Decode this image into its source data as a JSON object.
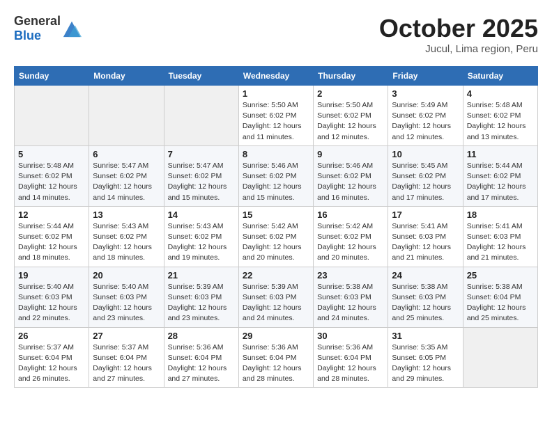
{
  "header": {
    "logo_general": "General",
    "logo_blue": "Blue",
    "month": "October 2025",
    "location": "Jucul, Lima region, Peru"
  },
  "weekdays": [
    "Sunday",
    "Monday",
    "Tuesday",
    "Wednesday",
    "Thursday",
    "Friday",
    "Saturday"
  ],
  "weeks": [
    [
      {
        "day": "",
        "info": ""
      },
      {
        "day": "",
        "info": ""
      },
      {
        "day": "",
        "info": ""
      },
      {
        "day": "1",
        "info": "Sunrise: 5:50 AM\nSunset: 6:02 PM\nDaylight: 12 hours\nand 11 minutes."
      },
      {
        "day": "2",
        "info": "Sunrise: 5:50 AM\nSunset: 6:02 PM\nDaylight: 12 hours\nand 12 minutes."
      },
      {
        "day": "3",
        "info": "Sunrise: 5:49 AM\nSunset: 6:02 PM\nDaylight: 12 hours\nand 12 minutes."
      },
      {
        "day": "4",
        "info": "Sunrise: 5:48 AM\nSunset: 6:02 PM\nDaylight: 12 hours\nand 13 minutes."
      }
    ],
    [
      {
        "day": "5",
        "info": "Sunrise: 5:48 AM\nSunset: 6:02 PM\nDaylight: 12 hours\nand 14 minutes."
      },
      {
        "day": "6",
        "info": "Sunrise: 5:47 AM\nSunset: 6:02 PM\nDaylight: 12 hours\nand 14 minutes."
      },
      {
        "day": "7",
        "info": "Sunrise: 5:47 AM\nSunset: 6:02 PM\nDaylight: 12 hours\nand 15 minutes."
      },
      {
        "day": "8",
        "info": "Sunrise: 5:46 AM\nSunset: 6:02 PM\nDaylight: 12 hours\nand 15 minutes."
      },
      {
        "day": "9",
        "info": "Sunrise: 5:46 AM\nSunset: 6:02 PM\nDaylight: 12 hours\nand 16 minutes."
      },
      {
        "day": "10",
        "info": "Sunrise: 5:45 AM\nSunset: 6:02 PM\nDaylight: 12 hours\nand 17 minutes."
      },
      {
        "day": "11",
        "info": "Sunrise: 5:44 AM\nSunset: 6:02 PM\nDaylight: 12 hours\nand 17 minutes."
      }
    ],
    [
      {
        "day": "12",
        "info": "Sunrise: 5:44 AM\nSunset: 6:02 PM\nDaylight: 12 hours\nand 18 minutes."
      },
      {
        "day": "13",
        "info": "Sunrise: 5:43 AM\nSunset: 6:02 PM\nDaylight: 12 hours\nand 18 minutes."
      },
      {
        "day": "14",
        "info": "Sunrise: 5:43 AM\nSunset: 6:02 PM\nDaylight: 12 hours\nand 19 minutes."
      },
      {
        "day": "15",
        "info": "Sunrise: 5:42 AM\nSunset: 6:02 PM\nDaylight: 12 hours\nand 20 minutes."
      },
      {
        "day": "16",
        "info": "Sunrise: 5:42 AM\nSunset: 6:02 PM\nDaylight: 12 hours\nand 20 minutes."
      },
      {
        "day": "17",
        "info": "Sunrise: 5:41 AM\nSunset: 6:03 PM\nDaylight: 12 hours\nand 21 minutes."
      },
      {
        "day": "18",
        "info": "Sunrise: 5:41 AM\nSunset: 6:03 PM\nDaylight: 12 hours\nand 21 minutes."
      }
    ],
    [
      {
        "day": "19",
        "info": "Sunrise: 5:40 AM\nSunset: 6:03 PM\nDaylight: 12 hours\nand 22 minutes."
      },
      {
        "day": "20",
        "info": "Sunrise: 5:40 AM\nSunset: 6:03 PM\nDaylight: 12 hours\nand 23 minutes."
      },
      {
        "day": "21",
        "info": "Sunrise: 5:39 AM\nSunset: 6:03 PM\nDaylight: 12 hours\nand 23 minutes."
      },
      {
        "day": "22",
        "info": "Sunrise: 5:39 AM\nSunset: 6:03 PM\nDaylight: 12 hours\nand 24 minutes."
      },
      {
        "day": "23",
        "info": "Sunrise: 5:38 AM\nSunset: 6:03 PM\nDaylight: 12 hours\nand 24 minutes."
      },
      {
        "day": "24",
        "info": "Sunrise: 5:38 AM\nSunset: 6:03 PM\nDaylight: 12 hours\nand 25 minutes."
      },
      {
        "day": "25",
        "info": "Sunrise: 5:38 AM\nSunset: 6:04 PM\nDaylight: 12 hours\nand 25 minutes."
      }
    ],
    [
      {
        "day": "26",
        "info": "Sunrise: 5:37 AM\nSunset: 6:04 PM\nDaylight: 12 hours\nand 26 minutes."
      },
      {
        "day": "27",
        "info": "Sunrise: 5:37 AM\nSunset: 6:04 PM\nDaylight: 12 hours\nand 27 minutes."
      },
      {
        "day": "28",
        "info": "Sunrise: 5:36 AM\nSunset: 6:04 PM\nDaylight: 12 hours\nand 27 minutes."
      },
      {
        "day": "29",
        "info": "Sunrise: 5:36 AM\nSunset: 6:04 PM\nDaylight: 12 hours\nand 28 minutes."
      },
      {
        "day": "30",
        "info": "Sunrise: 5:36 AM\nSunset: 6:04 PM\nDaylight: 12 hours\nand 28 minutes."
      },
      {
        "day": "31",
        "info": "Sunrise: 5:35 AM\nSunset: 6:05 PM\nDaylight: 12 hours\nand 29 minutes."
      },
      {
        "day": "",
        "info": ""
      }
    ]
  ]
}
